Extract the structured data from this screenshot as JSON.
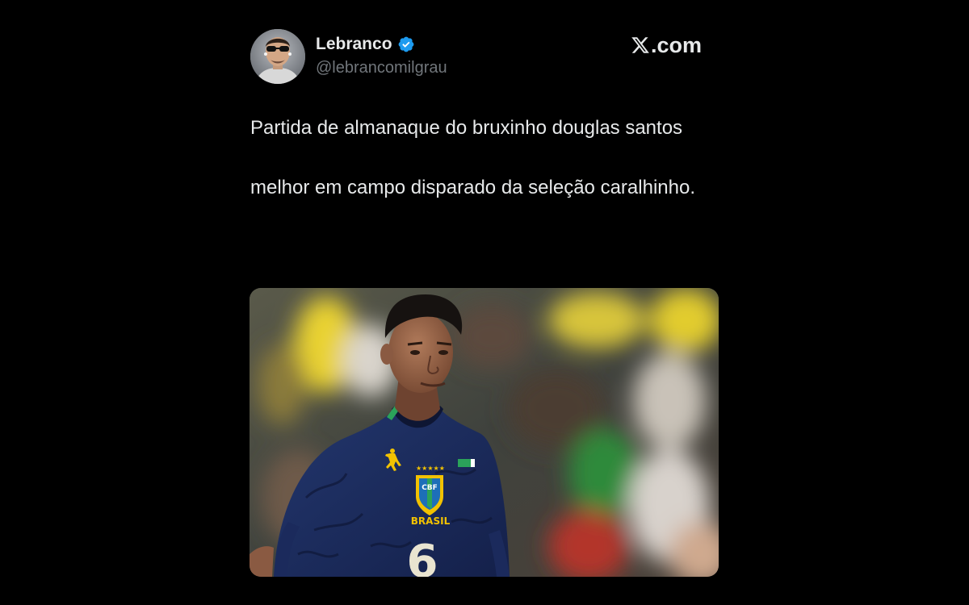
{
  "author": {
    "display_name": "Lebranco",
    "handle": "@lebrancomilgrau",
    "avatar_icon": "avatar-photo",
    "verified_icon": "verified-badge-icon"
  },
  "brand": {
    "label": ".com",
    "icon": "x-logo-icon"
  },
  "tweet": {
    "paragraphs": [
      "Partida de almanaque do bruxinho douglas santos",
      "melhor em campo disparado da seleção caralhinho."
    ]
  },
  "media": {
    "description_icon": "soccer-player-photo",
    "jersey_text": "BRASIL",
    "badge_text": "CBF",
    "jersey_number": "6"
  },
  "colors": {
    "background": "#000000",
    "text": "#e7e9ea",
    "secondary": "#71767b",
    "verified": "#1d9bf0",
    "jersey_navy": "#1b2a5c",
    "jersey_yellow": "#f2c200"
  }
}
